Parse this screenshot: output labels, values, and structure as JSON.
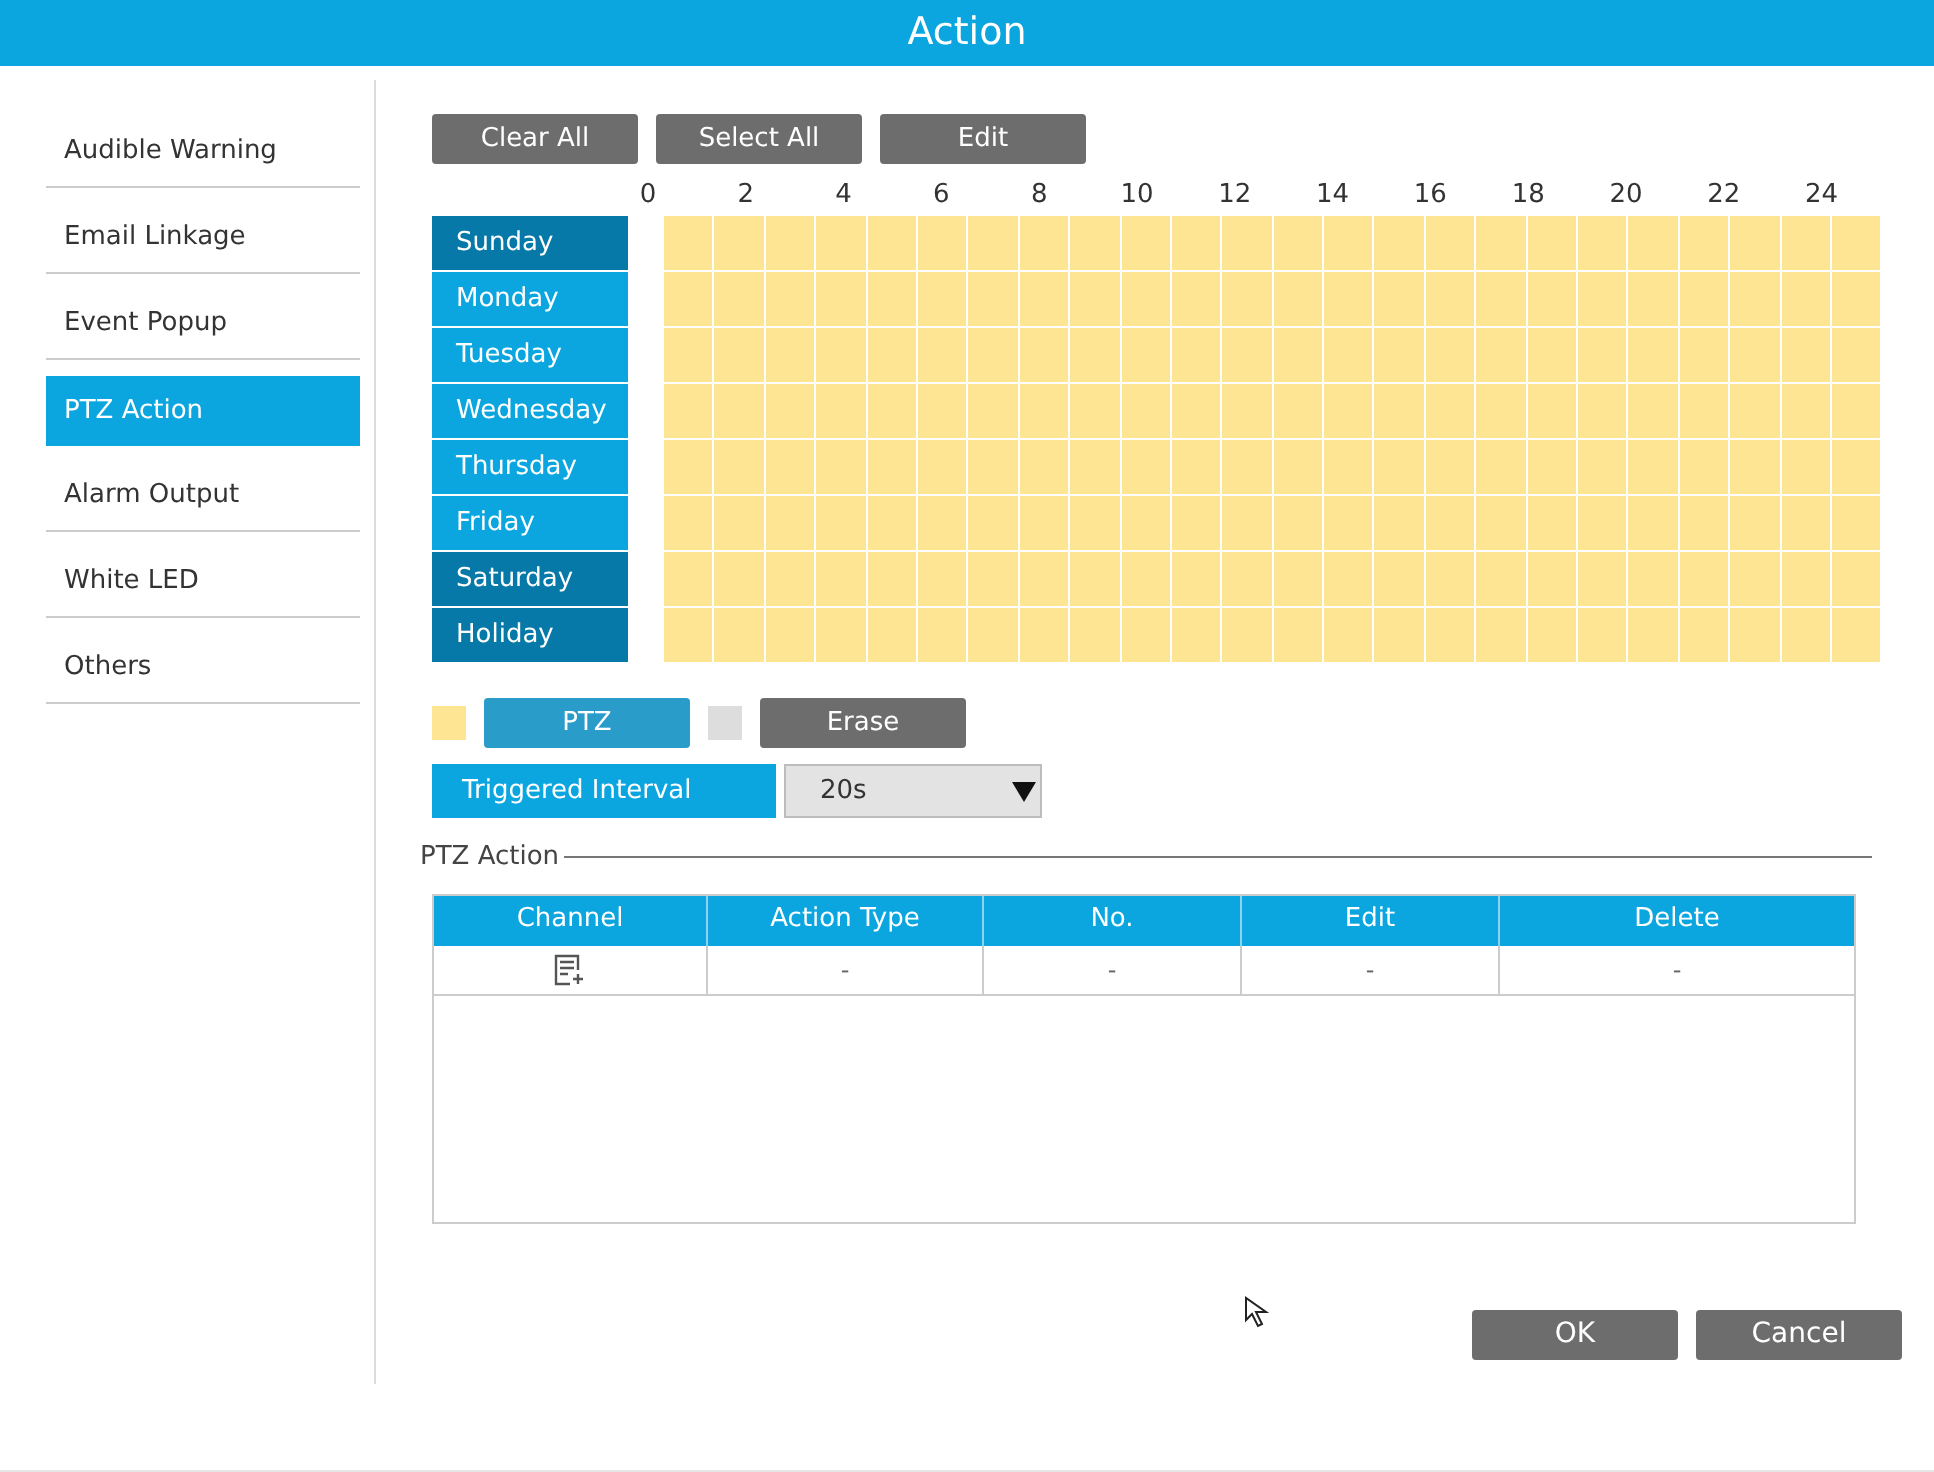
{
  "window": {
    "title": "Action"
  },
  "sidebar": {
    "items": [
      {
        "label": "Audible Warning",
        "selected": false
      },
      {
        "label": "Email Linkage",
        "selected": false
      },
      {
        "label": "Event Popup",
        "selected": false
      },
      {
        "label": "PTZ Action",
        "selected": true
      },
      {
        "label": "Alarm Output",
        "selected": false
      },
      {
        "label": "White LED",
        "selected": false
      },
      {
        "label": "Others",
        "selected": false
      }
    ]
  },
  "toolbar": [
    "Clear All",
    "Select All",
    "Edit"
  ],
  "schedule": {
    "hour_labels": [
      "0",
      "2",
      "4",
      "6",
      "8",
      "10",
      "12",
      "14",
      "16",
      "18",
      "20",
      "22",
      "24"
    ],
    "days": [
      {
        "label": "Sunday",
        "color": "#0779a8",
        "hours": [
          true,
          true,
          true,
          true,
          true,
          true,
          true,
          true,
          true,
          true,
          true,
          true,
          true,
          true,
          true,
          true,
          true,
          true,
          true,
          true,
          true,
          true,
          true,
          true
        ]
      },
      {
        "label": "Monday",
        "color": "#0ba6df",
        "hours": [
          true,
          true,
          true,
          true,
          true,
          true,
          true,
          true,
          true,
          true,
          true,
          true,
          true,
          true,
          true,
          true,
          true,
          true,
          true,
          true,
          true,
          true,
          true,
          true
        ]
      },
      {
        "label": "Tuesday",
        "color": "#0ba6df",
        "hours": [
          true,
          true,
          true,
          true,
          true,
          true,
          true,
          true,
          true,
          true,
          true,
          true,
          true,
          true,
          true,
          true,
          true,
          true,
          true,
          true,
          true,
          true,
          true,
          true
        ]
      },
      {
        "label": "Wednesday",
        "color": "#0ba6df",
        "hours": [
          true,
          true,
          true,
          true,
          true,
          true,
          true,
          true,
          true,
          true,
          true,
          true,
          true,
          true,
          true,
          true,
          true,
          true,
          true,
          true,
          true,
          true,
          true,
          true
        ]
      },
      {
        "label": "Thursday",
        "color": "#0ba6df",
        "hours": [
          true,
          true,
          true,
          true,
          true,
          true,
          true,
          true,
          true,
          true,
          true,
          true,
          true,
          true,
          true,
          true,
          true,
          true,
          true,
          true,
          true,
          true,
          true,
          true
        ]
      },
      {
        "label": "Friday",
        "color": "#0ba6df",
        "hours": [
          true,
          true,
          true,
          true,
          true,
          true,
          true,
          true,
          true,
          true,
          true,
          true,
          true,
          true,
          true,
          true,
          true,
          true,
          true,
          true,
          true,
          true,
          true,
          true
        ]
      },
      {
        "label": "Saturday",
        "color": "#0779a8",
        "hours": [
          true,
          true,
          true,
          true,
          true,
          true,
          true,
          true,
          true,
          true,
          true,
          true,
          true,
          true,
          true,
          true,
          true,
          true,
          true,
          true,
          true,
          true,
          true,
          true
        ]
      },
      {
        "label": "Holiday",
        "color": "#0779a8",
        "hours": [
          true,
          true,
          true,
          true,
          true,
          true,
          true,
          true,
          true,
          true,
          true,
          true,
          true,
          true,
          true,
          true,
          true,
          true,
          true,
          true,
          true,
          true,
          true,
          true
        ]
      }
    ]
  },
  "modes": [
    {
      "label": "PTZ",
      "color": "#fde594",
      "selected": true
    },
    {
      "label": "Erase",
      "color": "#dddddd",
      "selected": false
    }
  ],
  "triggered_interval": {
    "label": "Triggered Interval",
    "value": "20s"
  },
  "ptz_action": {
    "title": "PTZ Action",
    "columns": [
      "Channel",
      "Action Type",
      "No.",
      "Edit",
      "Delete"
    ],
    "rows": [
      {
        "cells": [
          "",
          "-",
          "-",
          "-",
          "-"
        ]
      }
    ]
  },
  "buttons": [
    "OK",
    "Cancel"
  ]
}
